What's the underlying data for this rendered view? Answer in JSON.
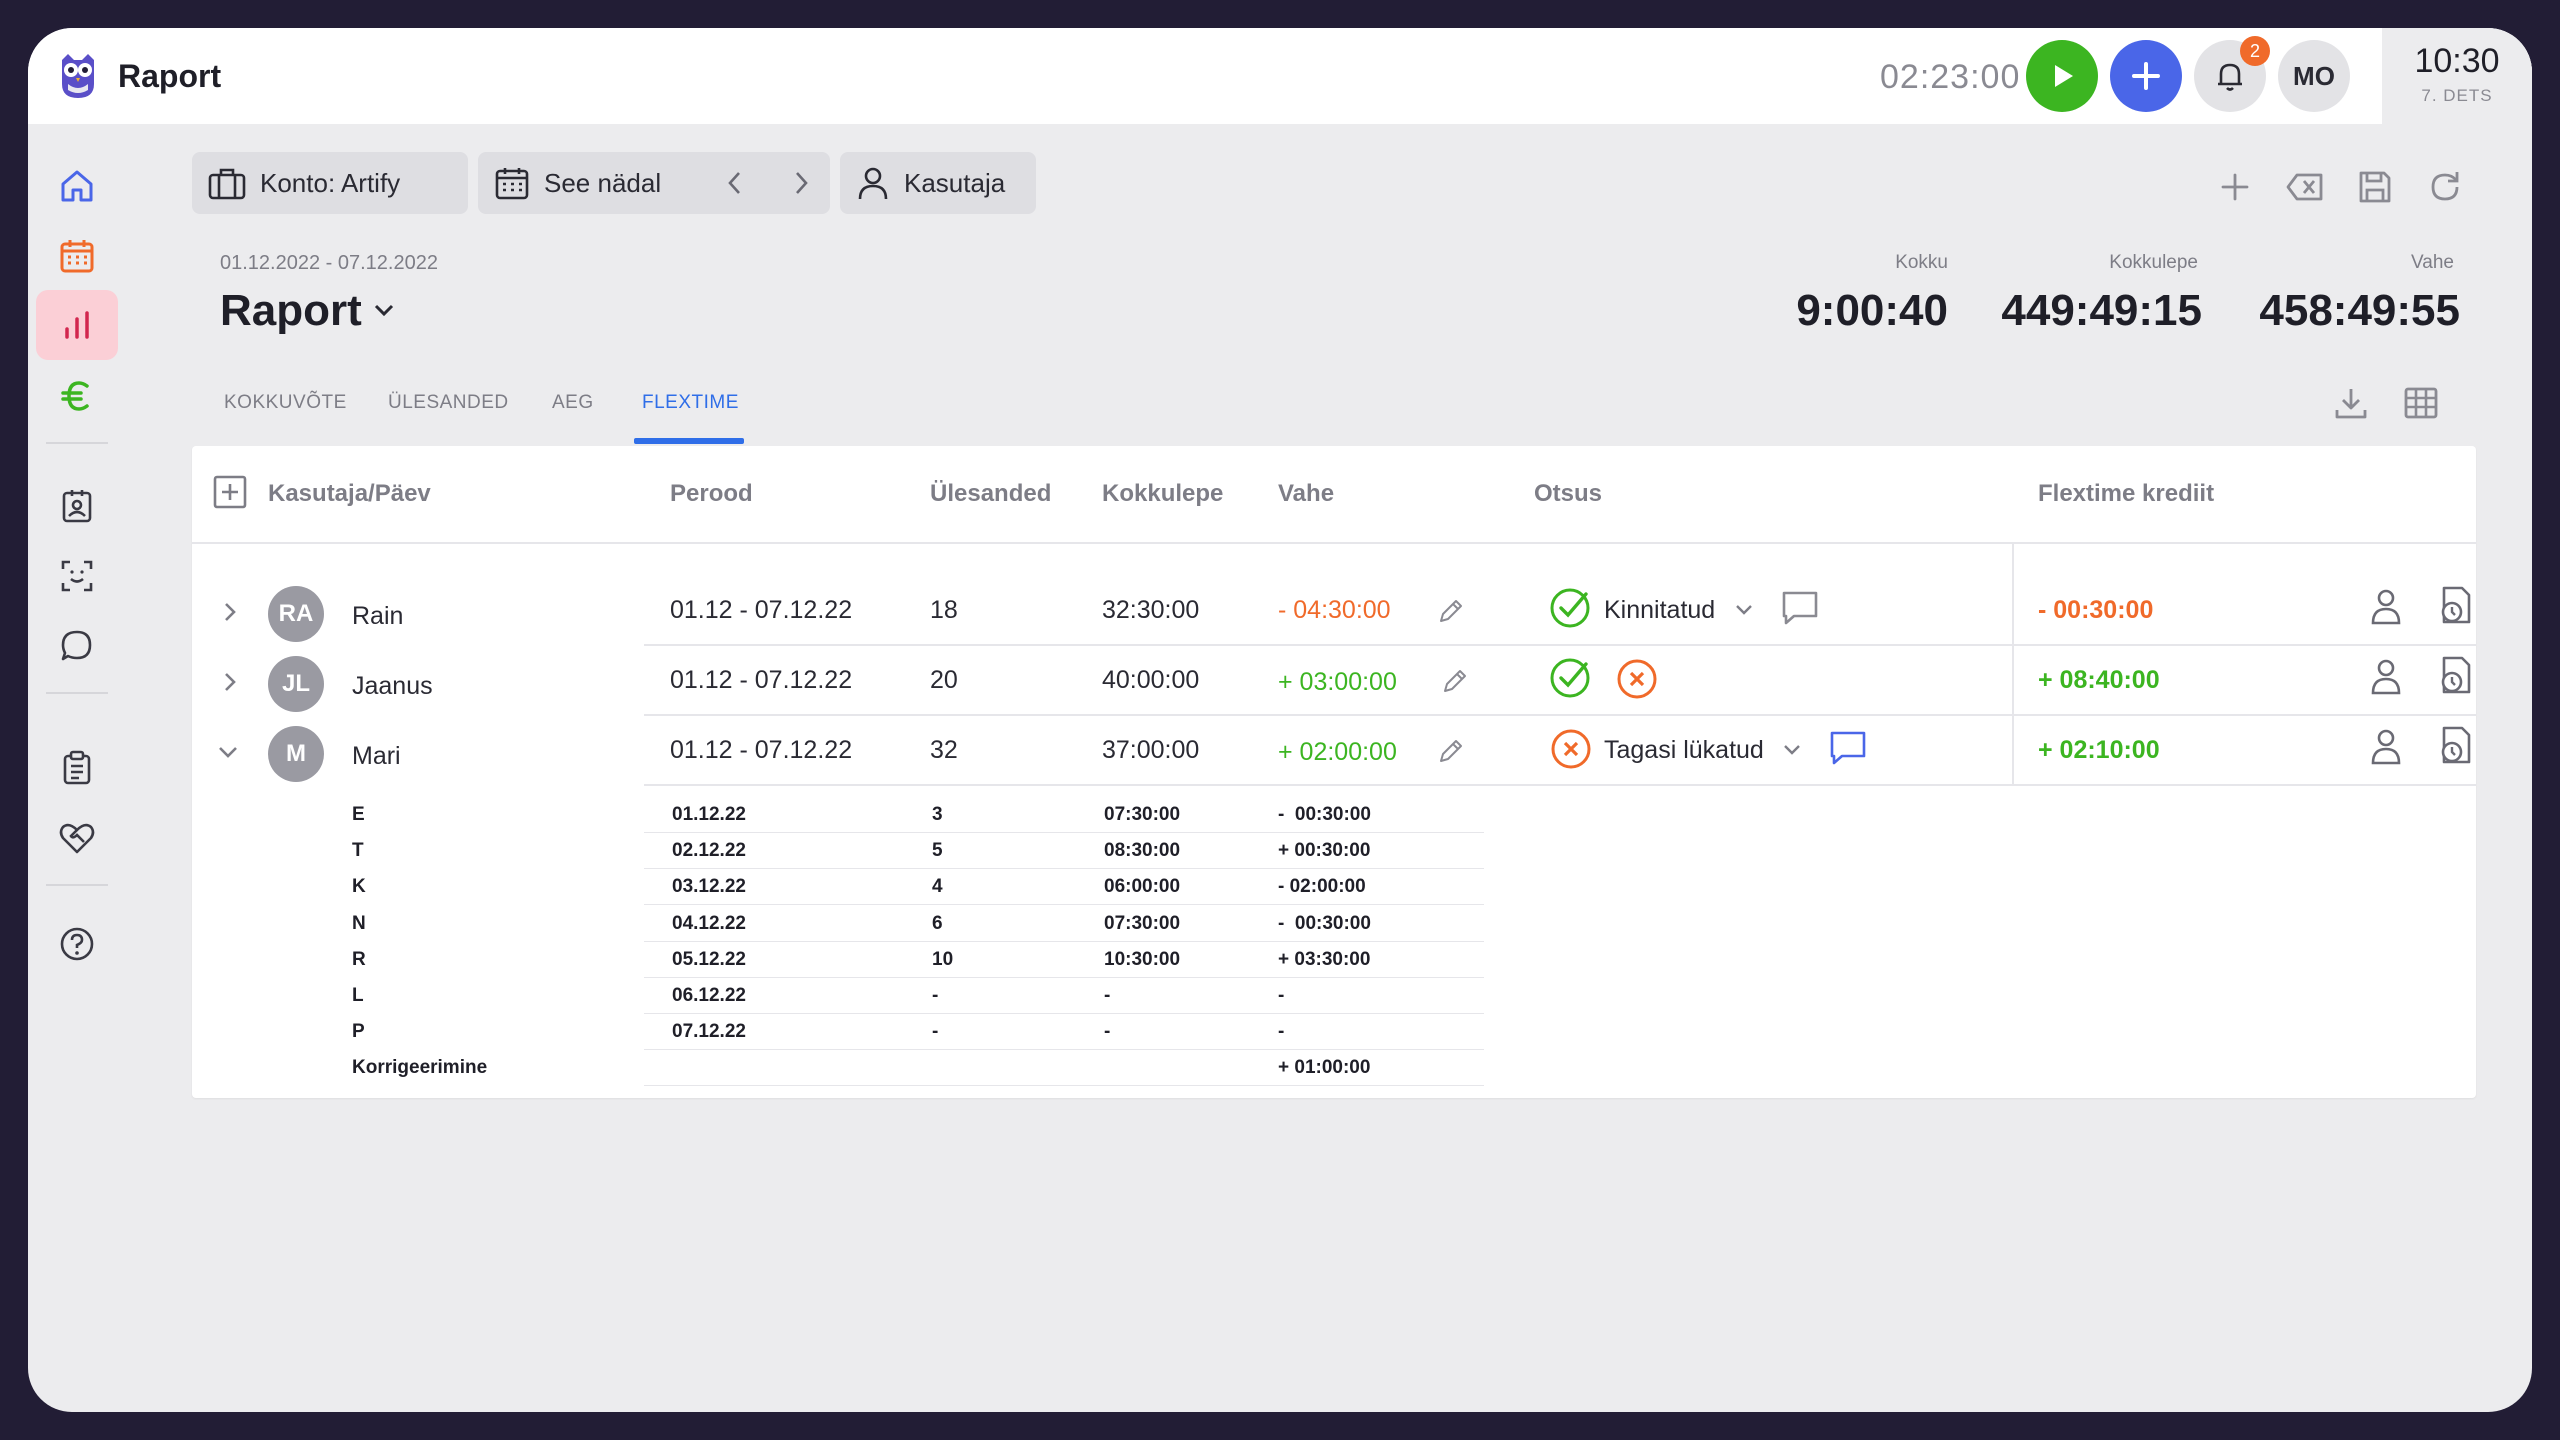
{
  "app": {
    "title": "Raport"
  },
  "topbar": {
    "timer": "02:23:00",
    "notifications_count": "2",
    "user_initials": "MO",
    "clock_time": "10:30",
    "clock_date": "7. DETS"
  },
  "filters": {
    "account": "Konto: Artify",
    "period": "See nädal",
    "user": "Kasutaja"
  },
  "page": {
    "date_range": "01.12.2022 - 07.12.2022",
    "title": "Raport"
  },
  "stats": [
    {
      "label": "Kokku",
      "value": "9:00:40"
    },
    {
      "label": "Kokkulepe",
      "value": "449:49:15"
    },
    {
      "label": "Vahe",
      "value": "458:49:55"
    }
  ],
  "tabs": [
    "KOKKUVÕTE",
    "ÜLESANDED",
    "AEG",
    "FLEXTIME"
  ],
  "table": {
    "headers": [
      "Kasutaja/Päev",
      "Perood",
      "Ülesanded",
      "Kokkulepe",
      "Vahe",
      "Otsus",
      "Flextime krediit"
    ],
    "rows": [
      {
        "initials": "RA",
        "name": "Rain",
        "period": "01.12 - 07.12.22",
        "tasks": "18",
        "agreed": "32:30:00",
        "diff": "- 04:30:00",
        "decision": "Kinnitatud",
        "credit": "- 00:30:00"
      },
      {
        "initials": "JL",
        "name": "Jaanus",
        "period": "01.12 - 07.12.22",
        "tasks": "20",
        "agreed": "40:00:00",
        "diff": "+ 03:00:00",
        "decision": "",
        "credit": "+ 08:40:00"
      },
      {
        "initials": "M",
        "name": "Mari",
        "period": "01.12 - 07.12.22",
        "tasks": "32",
        "agreed": "37:00:00",
        "diff": "+ 02:00:00",
        "decision": "Tagasi lükatud",
        "credit": "+ 02:10:00"
      }
    ],
    "days": [
      {
        "day": "E",
        "date": "01.12.22",
        "tasks": "3",
        "agreed": "07:30:00",
        "diff": "-  00:30:00"
      },
      {
        "day": "T",
        "date": "02.12.22",
        "tasks": "5",
        "agreed": "08:30:00",
        "diff": "+ 00:30:00"
      },
      {
        "day": "K",
        "date": "03.12.22",
        "tasks": "4",
        "agreed": "06:00:00",
        "diff": "- 02:00:00"
      },
      {
        "day": "N",
        "date": "04.12.22",
        "tasks": "6",
        "agreed": "07:30:00",
        "diff": "-  00:30:00"
      },
      {
        "day": "R",
        "date": "05.12.22",
        "tasks": "10",
        "agreed": "10:30:00",
        "diff": "+ 03:30:00"
      },
      {
        "day": "L",
        "date": "06.12.22",
        "tasks": "-",
        "agreed": "-",
        "diff": "-"
      },
      {
        "day": "P",
        "date": "07.12.22",
        "tasks": "-",
        "agreed": "-",
        "diff": "-"
      }
    ],
    "correction": {
      "label": "Korrigeerimine",
      "diff": "+ 01:00:00"
    }
  }
}
